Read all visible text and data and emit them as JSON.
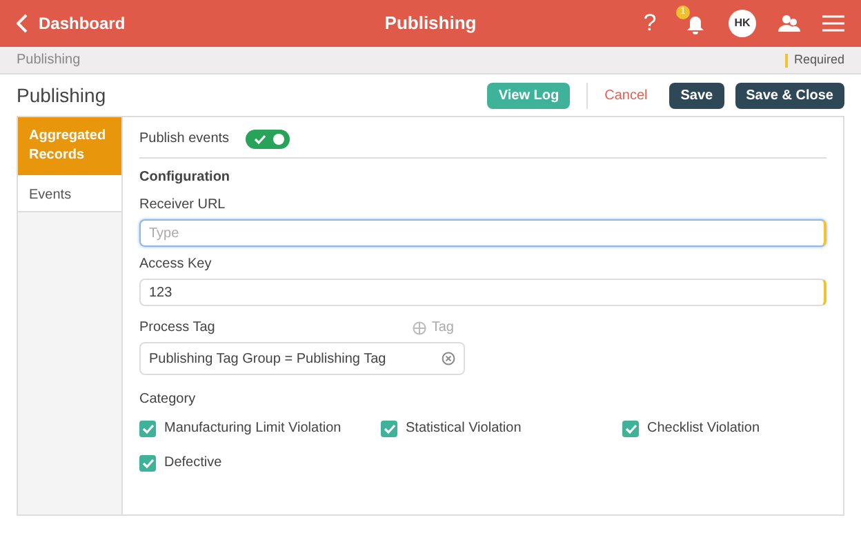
{
  "header": {
    "back_label": "Dashboard",
    "title": "Publishing",
    "help": "?",
    "notification_count": "1",
    "avatar": "HK"
  },
  "breadcrumb": {
    "path": "Publishing",
    "legend": "Required"
  },
  "page": {
    "title": "Publishing",
    "buttons": [
      {
        "label": "View Log",
        "kind": "secondary"
      },
      {
        "label": "Cancel",
        "kind": "link"
      },
      {
        "label": "Save",
        "kind": "primary"
      },
      {
        "label": "Save & Close",
        "kind": "primary"
      }
    ]
  },
  "sidebar": {
    "items": [
      {
        "label": "Aggregated Records",
        "selected": true
      },
      {
        "label": "Events",
        "selected": false
      }
    ]
  },
  "form": {
    "publish_events": {
      "label": "Publish events",
      "on": true
    },
    "section_title": "Configuration",
    "fields": [
      {
        "label": "Receiver URL",
        "placeholder": "Type",
        "required": true,
        "focused": true
      },
      {
        "label": "Access Key",
        "value": "123",
        "required": true,
        "focused": false
      }
    ],
    "process_tag": {
      "label": "Process Tag",
      "add_label": "Tag",
      "value": "Publishing Tag Group = Publishing Tag"
    },
    "category": {
      "label": "Category",
      "options": [
        {
          "label": "Manufacturing Limit Violation",
          "checked": true
        },
        {
          "label": "Statistical Violation",
          "checked": true
        },
        {
          "label": "Checklist Violation",
          "checked": true
        },
        {
          "label": "Defective",
          "checked": true
        }
      ]
    }
  }
}
